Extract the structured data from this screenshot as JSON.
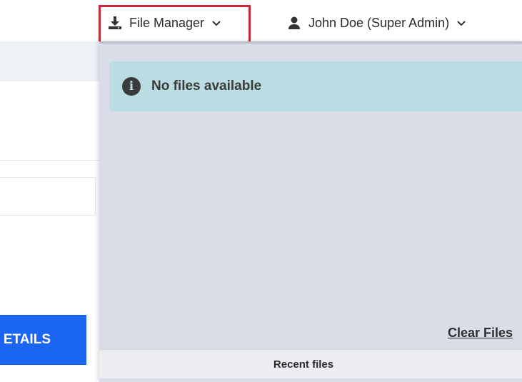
{
  "nav": {
    "file_manager": {
      "label": "File Manager",
      "icon": "download-icon"
    },
    "user": {
      "label": "John Doe (Super Admin)",
      "icon": "user-icon"
    }
  },
  "left_page": {
    "details_button_label": "ETAILS"
  },
  "file_manager_panel": {
    "alert": {
      "icon": "info-icon",
      "message": "No files available"
    },
    "clear_files_label": "Clear Files",
    "footer_tab_label": "Recent files"
  },
  "colors": {
    "highlight": "#c8283a",
    "primary_button": "#1a66f2",
    "alert_bg": "#b9dde2",
    "panel_bg": "#d9dde8"
  }
}
